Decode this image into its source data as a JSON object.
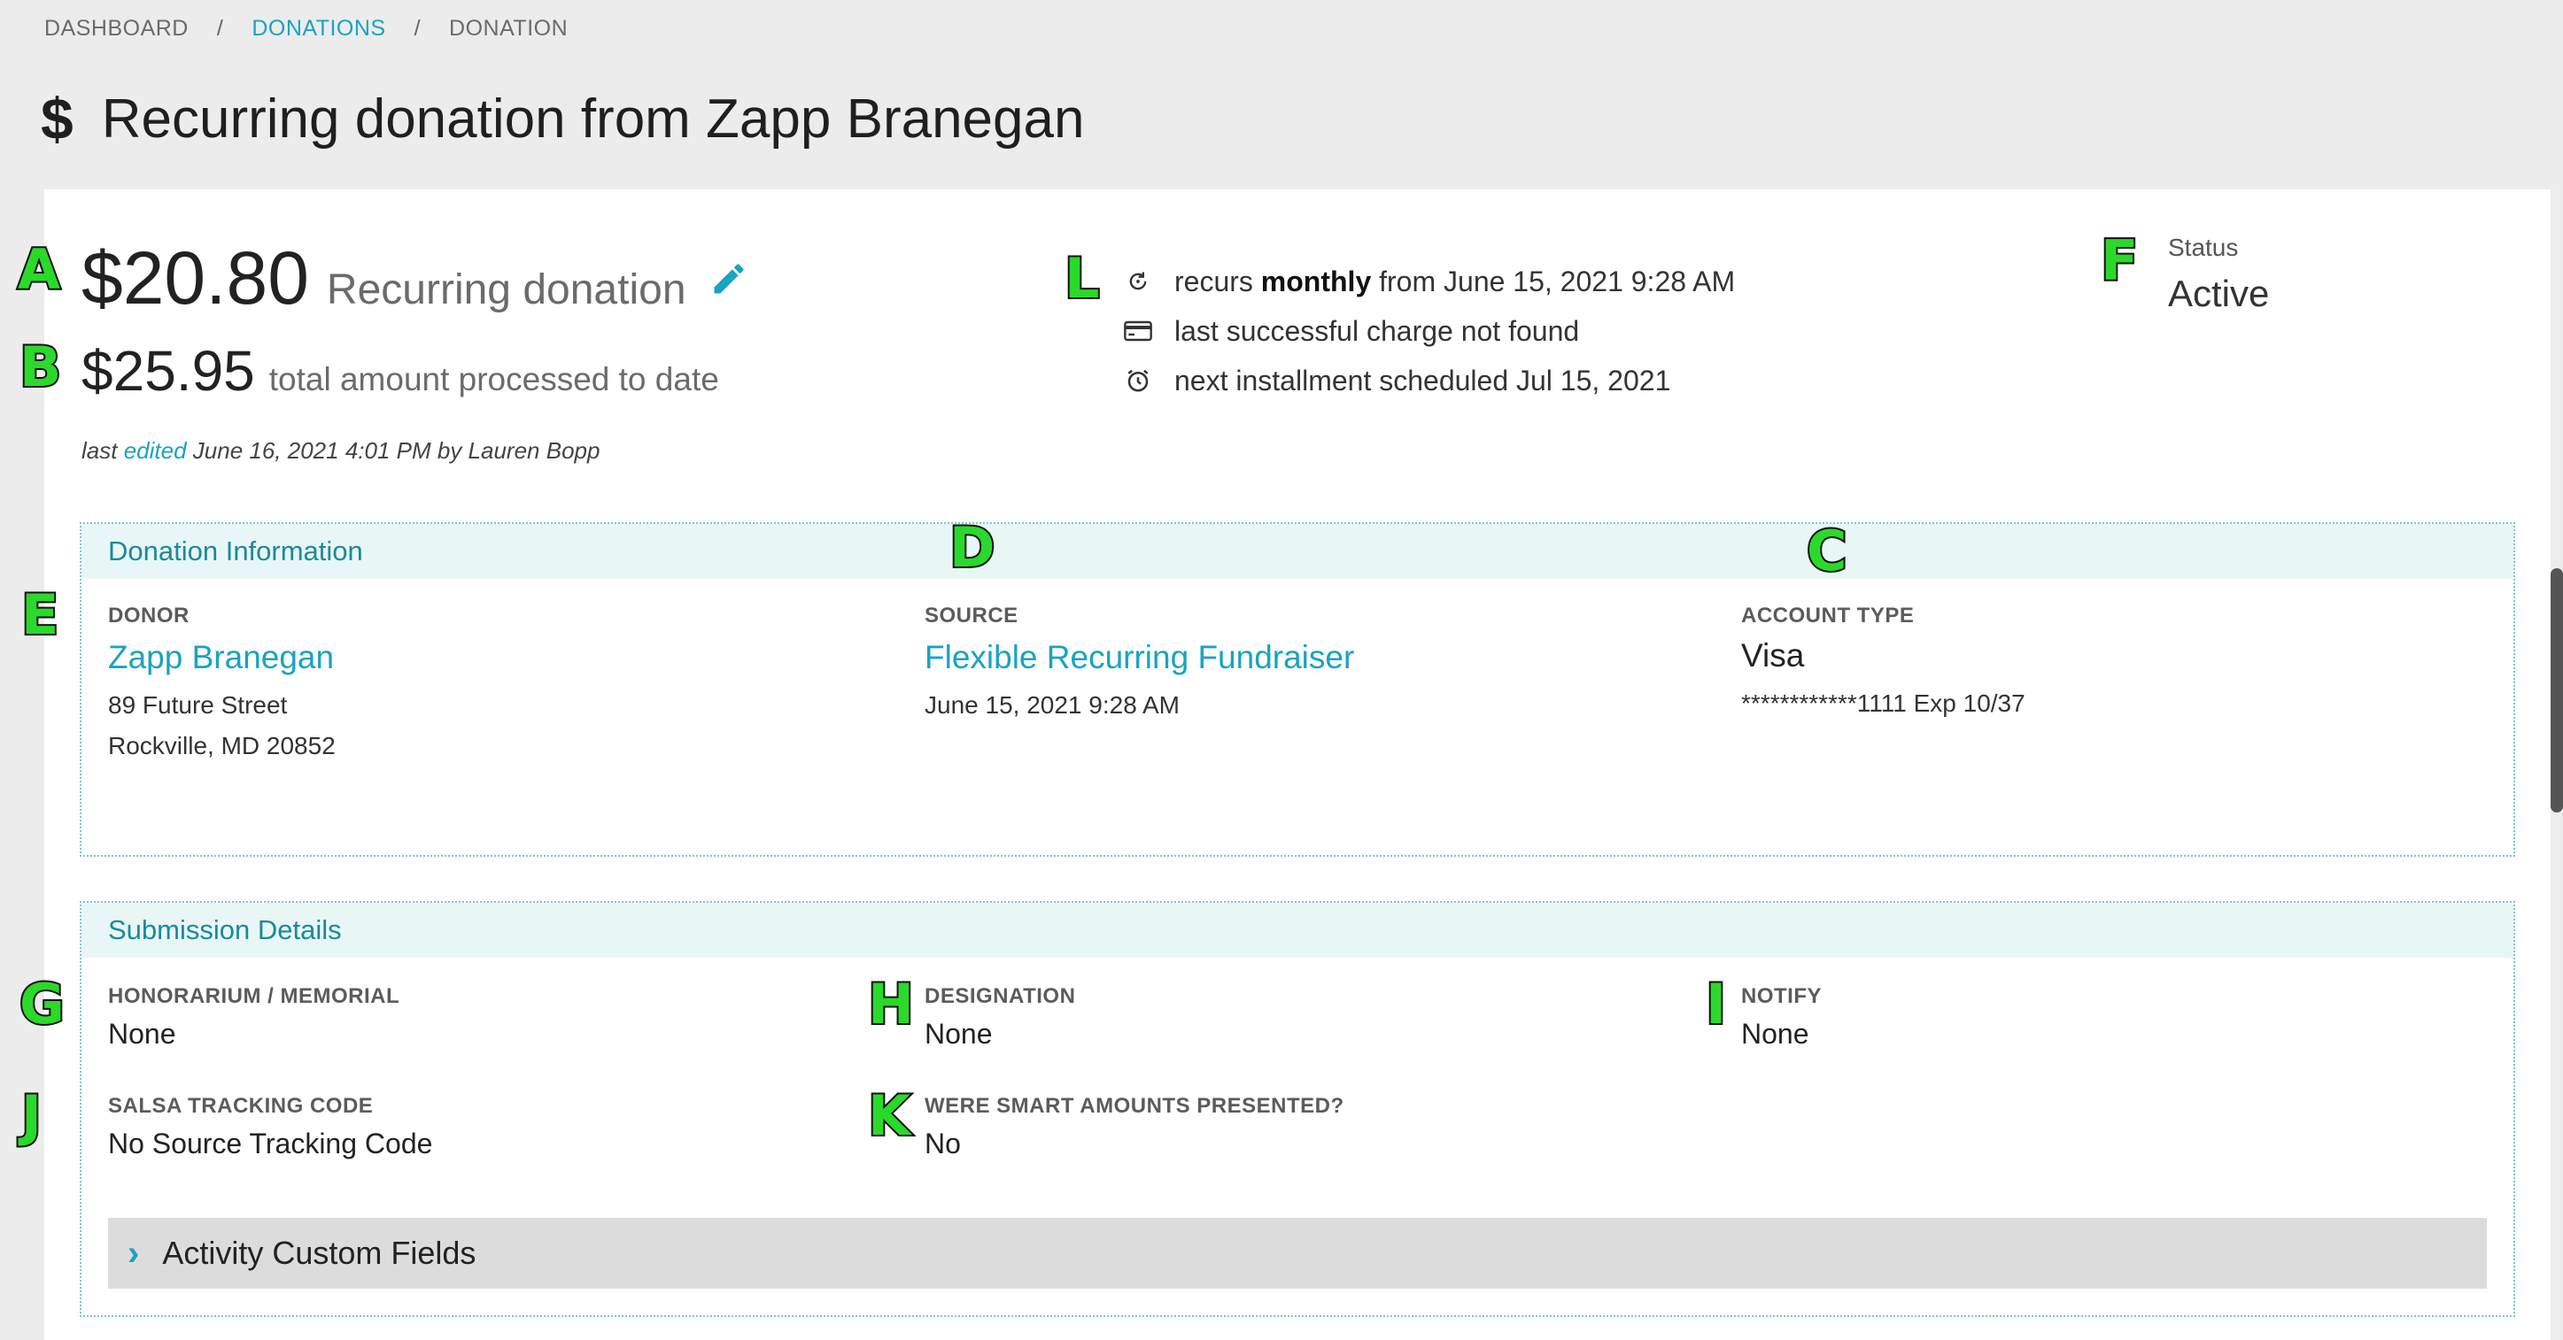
{
  "breadcrumb": {
    "items": [
      "DASHBOARD",
      "DONATIONS",
      "DONATION"
    ],
    "separator": "/"
  },
  "page": {
    "title": "Recurring donation from Zapp Branegan",
    "title_icon": "$"
  },
  "summary": {
    "amount": "$20.80",
    "amount_label": "Recurring donation",
    "total": "$25.95",
    "total_label": "total amount processed to date",
    "last_edited_prefix": "last",
    "last_edited_link": "edited",
    "last_edited_suffix": "June 16, 2021 4:01 PM by Lauren Bopp"
  },
  "recurrence": {
    "recurs_prefix": "recurs",
    "recurs_freq": "monthly",
    "recurs_suffix": "from June 15, 2021 9:28 AM",
    "last_charge": "last successful charge not found",
    "next_installment": "next installment scheduled Jul 15, 2021"
  },
  "status": {
    "label": "Status",
    "value": "Active"
  },
  "donation_info": {
    "header": "Donation Information",
    "donor_label": "DONOR",
    "donor_name": "Zapp Branegan",
    "donor_address_1": "89 Future Street",
    "donor_address_2": "Rockville, MD 20852",
    "source_label": "SOURCE",
    "source_name": "Flexible Recurring Fundraiser",
    "source_date": "June 15, 2021 9:28 AM",
    "account_label": "ACCOUNT TYPE",
    "account_type": "Visa",
    "account_number": "************1111 Exp 10/37"
  },
  "submission": {
    "header": "Submission Details",
    "honorarium_label": "HONORARIUM / MEMORIAL",
    "honorarium_value": "None",
    "designation_label": "DESIGNATION",
    "designation_value": "None",
    "notify_label": "NOTIFY",
    "notify_value": "None",
    "tracking_label": "SALSA TRACKING CODE",
    "tracking_value": "No Source Tracking Code",
    "smart_label": "WERE SMART AMOUNTS PRESENTED?",
    "smart_value": "No",
    "custom_fields": "Activity Custom Fields"
  },
  "markers": {
    "A": "A",
    "B": "B",
    "C": "C",
    "D": "D",
    "E": "E",
    "F": "F",
    "G": "G",
    "H": "H",
    "I": "I",
    "J": "J",
    "K": "K",
    "L": "L"
  },
  "colors": {
    "link": "#1aa3c2",
    "section_header_bg": "#e8f7f5",
    "marker": "#2bd92b"
  }
}
